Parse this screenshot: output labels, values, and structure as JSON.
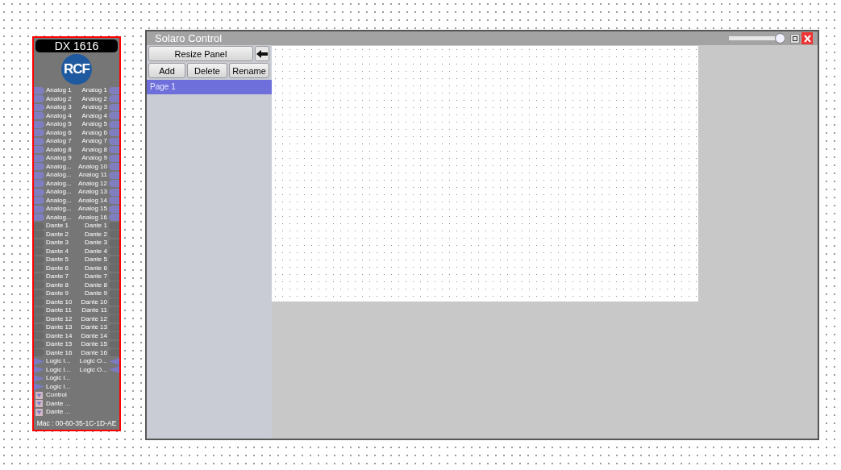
{
  "device": {
    "title": "DX 1616",
    "logo": "RCF",
    "mac": "Mac : 00-60-35-1C-1D-AE",
    "ports": [
      {
        "kind": "analog",
        "left": "Analog 1",
        "right": "Analog 1"
      },
      {
        "kind": "analog",
        "left": "Analog 2",
        "right": "Analog 2"
      },
      {
        "kind": "analog",
        "left": "Analog 3",
        "right": "Analog 3"
      },
      {
        "kind": "analog",
        "left": "Analog 4",
        "right": "Analog 4"
      },
      {
        "kind": "analog",
        "left": "Analog 5",
        "right": "Analog 5"
      },
      {
        "kind": "analog",
        "left": "Analog 6",
        "right": "Analog 6"
      },
      {
        "kind": "analog",
        "left": "Analog 7",
        "right": "Analog 7"
      },
      {
        "kind": "analog",
        "left": "Analog 8",
        "right": "Analog 8"
      },
      {
        "kind": "analog",
        "left": "Analog 9",
        "right": "Analog 9"
      },
      {
        "kind": "analog",
        "left": "Analog...",
        "right": "Analog 10"
      },
      {
        "kind": "analog",
        "left": "Analog...",
        "right": "Analog 11"
      },
      {
        "kind": "analog",
        "left": "Analog...",
        "right": "Analog 12"
      },
      {
        "kind": "analog",
        "left": "Analog...",
        "right": "Analog 13"
      },
      {
        "kind": "analog",
        "left": "Analog...",
        "right": "Analog 14"
      },
      {
        "kind": "analog",
        "left": "Analog...",
        "right": "Analog 15"
      },
      {
        "kind": "analog",
        "left": "Analog...",
        "right": "Analog 16"
      },
      {
        "kind": "dante",
        "left": "Dante 1",
        "right": "Dante 1"
      },
      {
        "kind": "dante",
        "left": "Dante 2",
        "right": "Dante 2"
      },
      {
        "kind": "dante",
        "left": "Dante 3",
        "right": "Dante 3"
      },
      {
        "kind": "dante",
        "left": "Dante 4",
        "right": "Dante 4"
      },
      {
        "kind": "dante",
        "left": "Dante 5",
        "right": "Dante 5"
      },
      {
        "kind": "dante",
        "left": "Dante 6",
        "right": "Dante 6"
      },
      {
        "kind": "dante",
        "left": "Dante 7",
        "right": "Dante 7"
      },
      {
        "kind": "dante",
        "left": "Dante 8",
        "right": "Dante 8"
      },
      {
        "kind": "dante",
        "left": "Dante 9",
        "right": "Dante 9"
      },
      {
        "kind": "dante",
        "left": "Dante 10",
        "right": "Dante 10"
      },
      {
        "kind": "dante",
        "left": "Dante 11",
        "right": "Dante 11"
      },
      {
        "kind": "dante",
        "left": "Dante 12",
        "right": "Dante 12"
      },
      {
        "kind": "dante",
        "left": "Dante 13",
        "right": "Dante 13"
      },
      {
        "kind": "dante",
        "left": "Dante 14",
        "right": "Dante 14"
      },
      {
        "kind": "dante",
        "left": "Dante 15",
        "right": "Dante 15"
      },
      {
        "kind": "dante",
        "left": "Dante 16",
        "right": "Dante 16"
      },
      {
        "kind": "logic",
        "left": "Logic I...",
        "right": "Logic O..."
      },
      {
        "kind": "logic",
        "left": "Logic I...",
        "right": "Logic O..."
      },
      {
        "kind": "logic",
        "left": "Logic I..."
      },
      {
        "kind": "logic",
        "left": "Logic I..."
      },
      {
        "kind": "control",
        "left": "Control"
      },
      {
        "kind": "control",
        "left": "Dante ..."
      },
      {
        "kind": "control",
        "left": "Dante ..."
      }
    ]
  },
  "window": {
    "title": "Solaro Control",
    "zoom": {
      "level": 1.0
    },
    "buttons": {
      "resize": "Resize Panel",
      "add": "Add",
      "delete": "Delete",
      "rename": "Rename"
    },
    "pages": [
      {
        "label": "Page 1",
        "selected": true
      }
    ]
  }
}
